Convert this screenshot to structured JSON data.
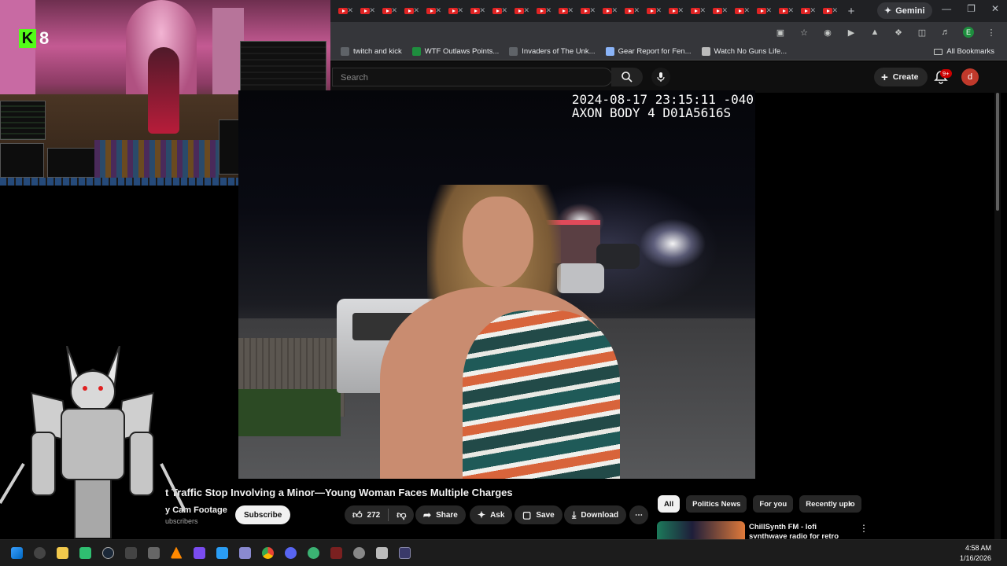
{
  "browser": {
    "tab_count": 23,
    "new_tab": "+",
    "gemini_label": "Gemini",
    "bookmarks": [
      {
        "label": "twitch and kick",
        "icon": "folder-icon"
      },
      {
        "label": "WTF Outlaws Points...",
        "icon": "spreadsheet-icon"
      },
      {
        "label": "Invaders of The Unk...",
        "icon": "game-icon"
      },
      {
        "label": "Gear Report for Fen...",
        "icon": "wow-icon"
      },
      {
        "label": "Watch No Guns Life...",
        "icon": "anime-icon"
      }
    ],
    "all_bookmarks": "All Bookmarks",
    "profile_letter": "E"
  },
  "youtube": {
    "search_placeholder": "Search",
    "create_label": "Create",
    "notif_badge": "9+",
    "avatar_letter": "d",
    "video_title": "Traffic Stop Involving a Minor—Young Woman Faces Multiple Charges",
    "video_title_prefix": "t",
    "channel": "Cam Footage",
    "channel_prefix": "y",
    "subscribers": "ubscribers",
    "subscribe": "Subscribe",
    "likes": "272",
    "share": "Share",
    "ask": "Ask",
    "save": "Save",
    "download": "Download",
    "more": "⋯",
    "bodycam_line1": "2024-08-17 23:15:11 -040",
    "bodycam_line2": "AXON BODY 4 D01A5616S",
    "chips": [
      "All",
      "Politics News",
      "For you",
      "Recently uplo"
    ],
    "recommendation": "ChillSynth FM - lofi synthwave radio for retro dreaming"
  },
  "overlay": {
    "kick_count": "8"
  },
  "taskbar": {
    "time": "4:58 AM",
    "date": "1/16/2026"
  }
}
